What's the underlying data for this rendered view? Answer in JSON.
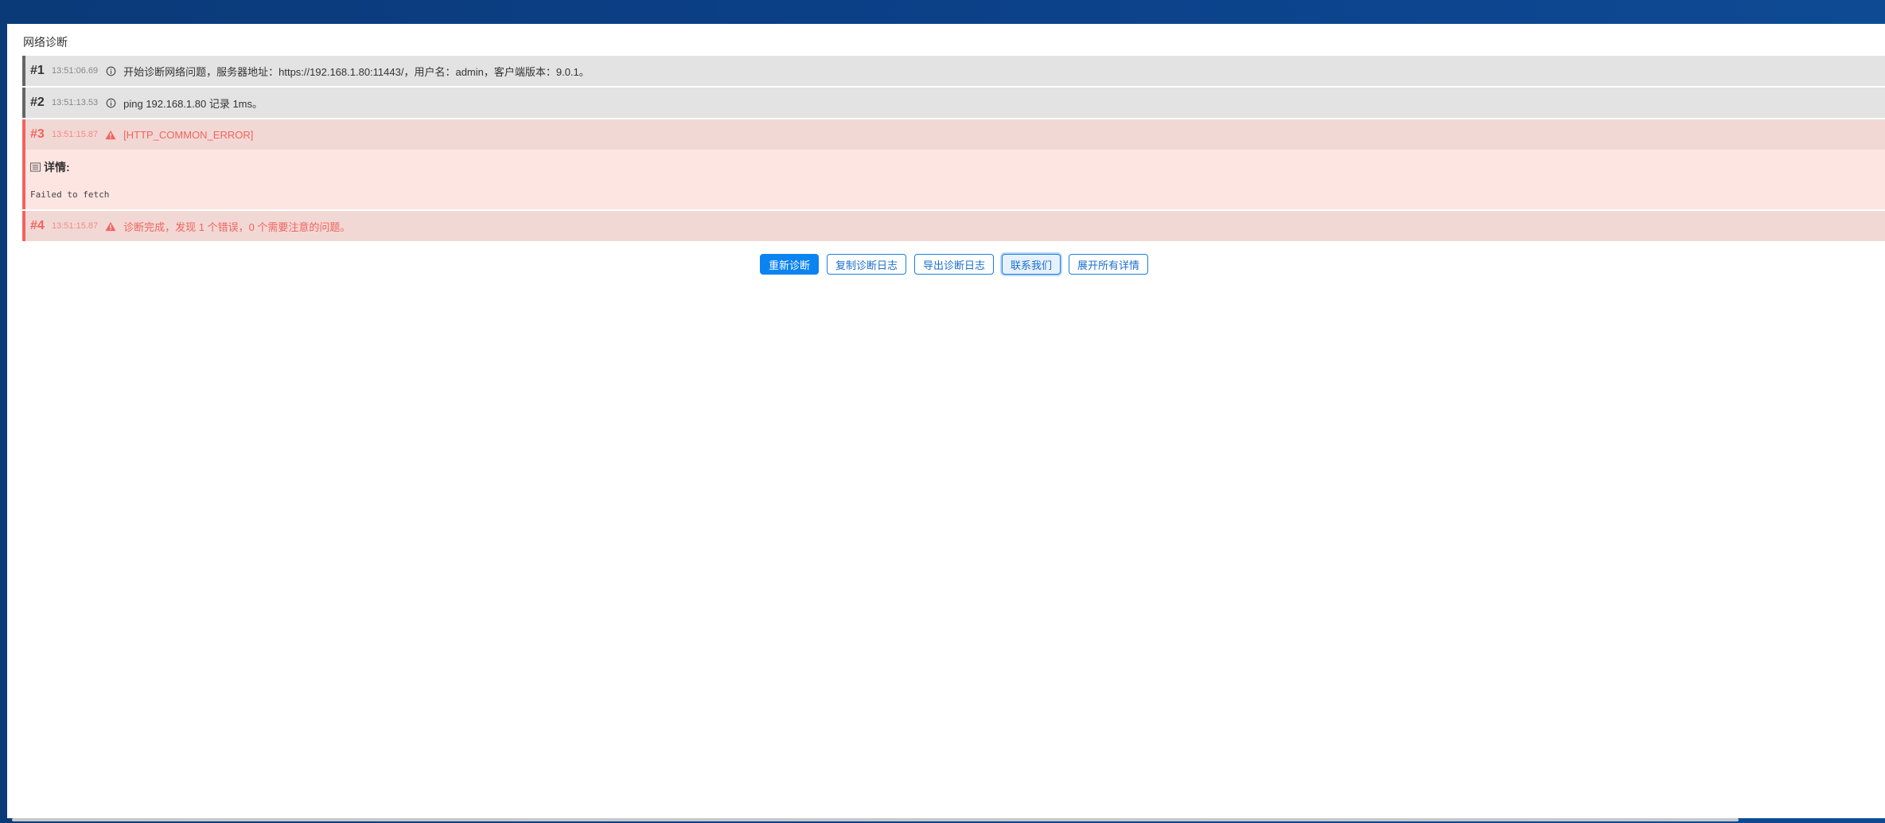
{
  "window": {
    "title": "网络诊断"
  },
  "log": [
    {
      "num": "#1",
      "time": "13:51:06.69",
      "level": "info",
      "icon": "info-circle-icon",
      "message": "开始诊断网络问题，服务器地址：https://192.168.1.80:11443/，用户名：admin，客户端版本：9.0.1。"
    },
    {
      "num": "#2",
      "time": "13:51:13.53",
      "level": "info",
      "icon": "info-circle-icon",
      "message": "ping 192.168.1.80 记录 1ms。"
    },
    {
      "num": "#3",
      "time": "13:51:15.87",
      "level": "error",
      "icon": "warning-triangle-icon",
      "message": "[HTTP_COMMON_ERROR]",
      "details_title": "详情:",
      "details_icon": "list-icon",
      "details_body": "Failed to fetch"
    },
    {
      "num": "#4",
      "time": "13:51:15.87",
      "level": "error",
      "icon": "warning-triangle-icon",
      "message": "诊断完成，发现 1 个错误，0 个需要注意的问题。"
    }
  ],
  "actions": {
    "rediagnose": "重新诊断",
    "copy_log": "复制诊断日志",
    "export_log": "导出诊断日志",
    "contact_us": "联系我们",
    "expand_all": "展开所有详情"
  },
  "colors": {
    "primary": "#0b83f0",
    "error": "#f0645f",
    "info_bg": "#e3e3e3",
    "error_bg": "#f2d8d4"
  }
}
